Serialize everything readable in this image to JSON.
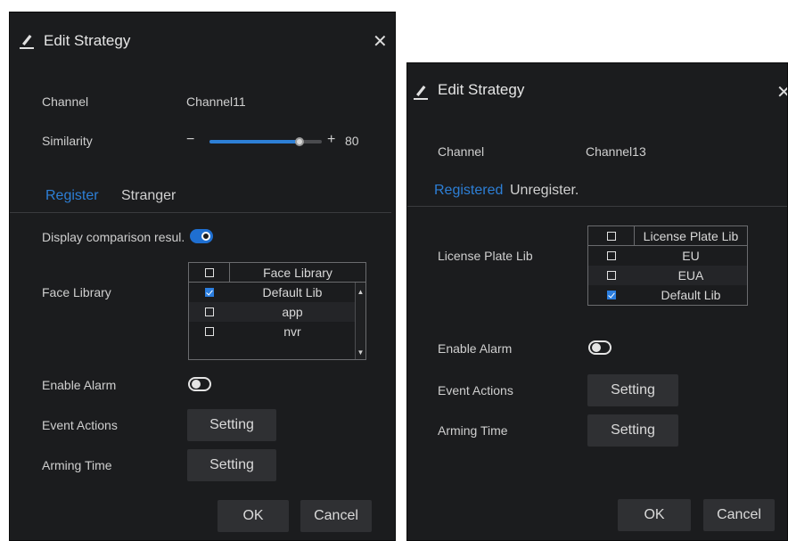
{
  "dialog1": {
    "title": "Edit Strategy",
    "close_icon": "close-icon",
    "channel_label": "Channel",
    "channel_value": "Channel11",
    "similarity_label": "Similarity",
    "similarity_minus": "−",
    "similarity_plus": "+",
    "similarity_value": "80",
    "similarity_level_percent": 80,
    "tabs": [
      {
        "label": "Register",
        "active": true
      },
      {
        "label": "Stranger",
        "active": false
      }
    ],
    "display_comparison_label": "Display comparison resul.",
    "display_comparison_on": true,
    "face_library_label": "Face Library",
    "face_table": {
      "header": "Face Library",
      "rows": [
        {
          "name": "Default Lib",
          "checked": true
        },
        {
          "name": "app",
          "checked": false
        },
        {
          "name": "nvr",
          "checked": false
        }
      ]
    },
    "enable_alarm_label": "Enable Alarm",
    "enable_alarm_on": false,
    "event_actions_label": "Event Actions",
    "event_actions_button": "Setting",
    "arming_time_label": "Arming Time",
    "arming_time_button": "Setting",
    "ok_button": "OK",
    "cancel_button": "Cancel"
  },
  "dialog2": {
    "title": "Edit Strategy",
    "close_icon": "close-icon",
    "channel_label": "Channel",
    "channel_value": "Channel13",
    "tabs": [
      {
        "label": "Registered",
        "active": true
      },
      {
        "label": "Unregister.",
        "active": false
      }
    ],
    "license_plate_label": "License Plate Lib",
    "plate_table": {
      "header": "License Plate Lib",
      "rows": [
        {
          "name": "EU",
          "checked": false
        },
        {
          "name": "EUA",
          "checked": false
        },
        {
          "name": "Default Lib",
          "checked": true
        }
      ]
    },
    "enable_alarm_label": "Enable Alarm",
    "enable_alarm_on": false,
    "event_actions_label": "Event Actions",
    "event_actions_button": "Setting",
    "arming_time_label": "Arming Time",
    "arming_time_button": "Setting",
    "ok_button": "OK",
    "cancel_button": "Cancel"
  },
  "colors": {
    "dialog_bg": "#1b1c1e",
    "accent": "#2d7fd6",
    "button_bg": "#2f3033"
  }
}
